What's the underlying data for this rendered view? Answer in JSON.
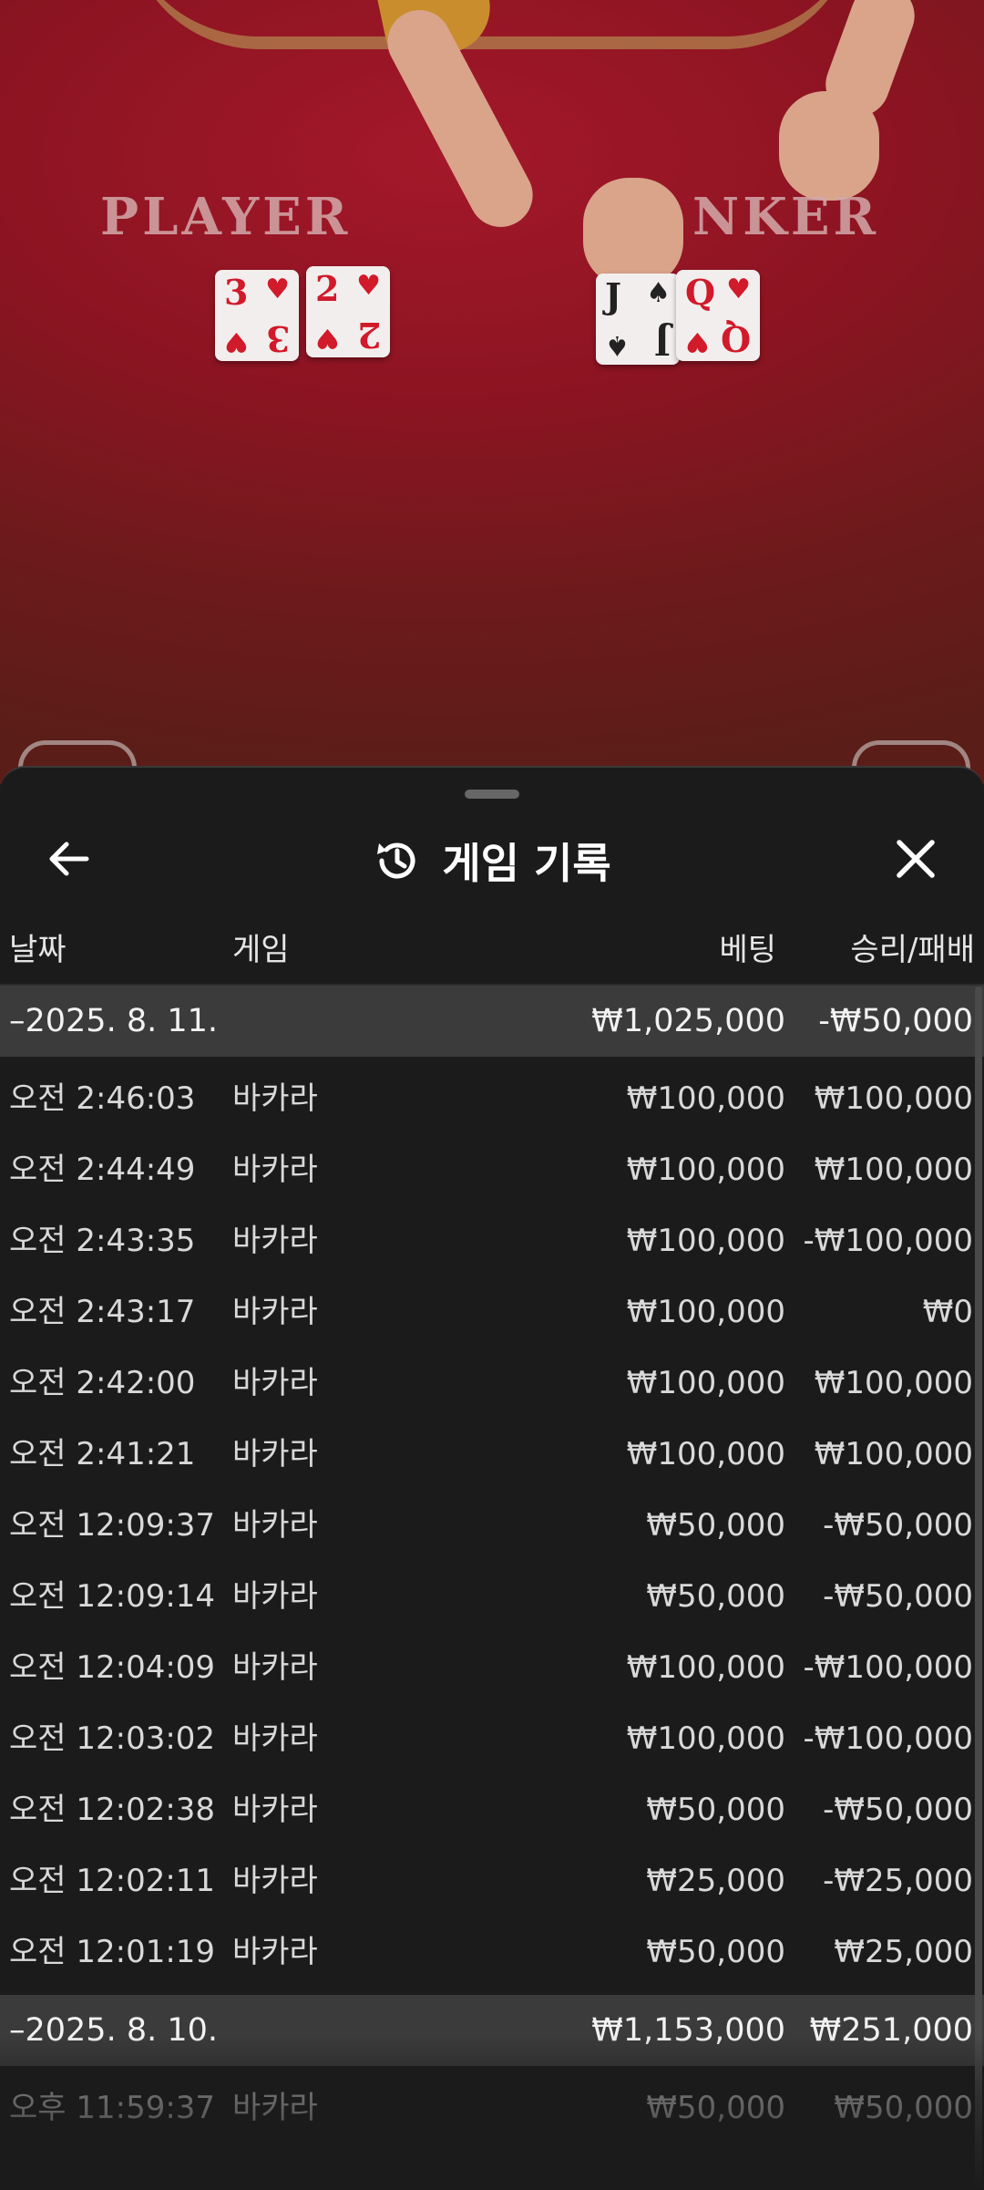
{
  "video": {
    "player_label": "PLAYER",
    "banker_label": "NKER",
    "player_cards": [
      {
        "rank": "3",
        "suit": "♥"
      },
      {
        "rank": "2",
        "suit": "♥"
      }
    ],
    "banker_cards": [
      {
        "rank": "J",
        "suit": "♠"
      },
      {
        "rank": "Q",
        "suit": "♥"
      }
    ]
  },
  "header": {
    "back_icon": "arrow-left-icon",
    "history_icon": "history-icon",
    "title": "게임 기록",
    "close_icon": "close-icon"
  },
  "columns": {
    "date": "날짜",
    "game": "게임",
    "bet": "베팅",
    "result": "승리/패배"
  },
  "groups": [
    {
      "date": "–2025. 8. 11.",
      "bet_total": "₩1,025,000",
      "result_total": "-₩50,000",
      "rows": [
        {
          "time": "오전 2:46:03",
          "game": "바카라",
          "bet": "₩100,000",
          "result": "₩100,000"
        },
        {
          "time": "오전 2:44:49",
          "game": "바카라",
          "bet": "₩100,000",
          "result": "₩100,000"
        },
        {
          "time": "오전 2:43:35",
          "game": "바카라",
          "bet": "₩100,000",
          "result": "-₩100,000"
        },
        {
          "time": "오전 2:43:17",
          "game": "바카라",
          "bet": "₩100,000",
          "result": "₩0"
        },
        {
          "time": "오전 2:42:00",
          "game": "바카라",
          "bet": "₩100,000",
          "result": "₩100,000"
        },
        {
          "time": "오전 2:41:21",
          "game": "바카라",
          "bet": "₩100,000",
          "result": "₩100,000"
        },
        {
          "time": "오전 12:09:37",
          "game": "바카라",
          "bet": "₩50,000",
          "result": "-₩50,000"
        },
        {
          "time": "오전 12:09:14",
          "game": "바카라",
          "bet": "₩50,000",
          "result": "-₩50,000"
        },
        {
          "time": "오전 12:04:09",
          "game": "바카라",
          "bet": "₩100,000",
          "result": "-₩100,000"
        },
        {
          "time": "오전 12:03:02",
          "game": "바카라",
          "bet": "₩100,000",
          "result": "-₩100,000"
        },
        {
          "time": "오전 12:02:38",
          "game": "바카라",
          "bet": "₩50,000",
          "result": "-₩50,000"
        },
        {
          "time": "오전 12:02:11",
          "game": "바카라",
          "bet": "₩25,000",
          "result": "-₩25,000"
        },
        {
          "time": "오전 12:01:19",
          "game": "바카라",
          "bet": "₩50,000",
          "result": "₩25,000"
        }
      ]
    },
    {
      "date": "–2025. 8. 10.",
      "bet_total": "₩1,153,000",
      "result_total": "₩251,000",
      "rows": [
        {
          "time": "오후 11:59:37",
          "game": "바카라",
          "bet": "₩50,000",
          "result": "₩50,000"
        }
      ]
    }
  ]
}
